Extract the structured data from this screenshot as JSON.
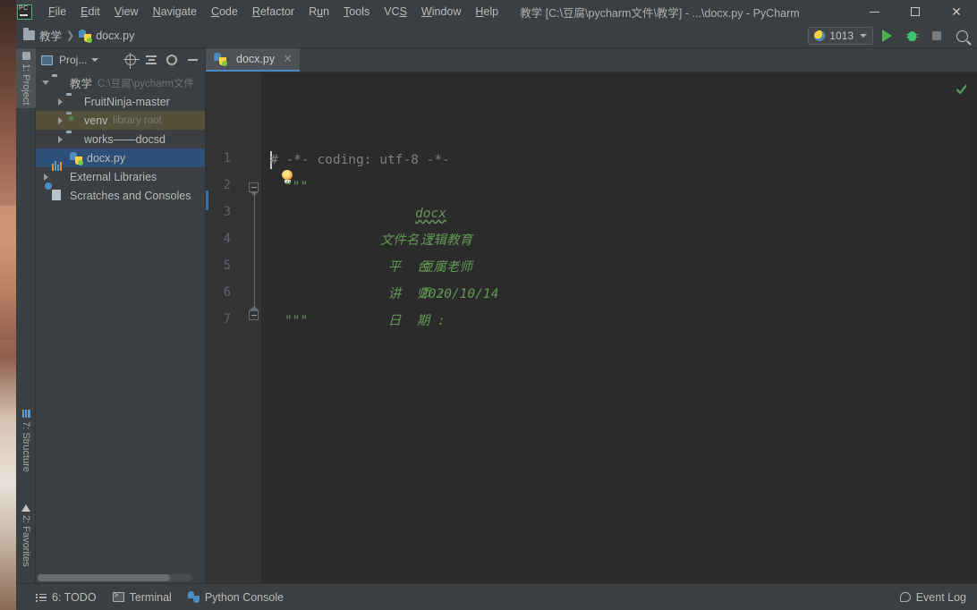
{
  "window": {
    "title": "教学 [C:\\豆腐\\pycharm文件\\教学] - ...\\docx.py - PyCharm",
    "app_logo": "pycharm-logo",
    "minimize": "—",
    "maximize": "□",
    "close": "✕"
  },
  "menu": [
    {
      "label": "File",
      "accel": "F"
    },
    {
      "label": "Edit",
      "accel": "E"
    },
    {
      "label": "View",
      "accel": "V"
    },
    {
      "label": "Navigate",
      "accel": "N"
    },
    {
      "label": "Code",
      "accel": "C"
    },
    {
      "label": "Refactor",
      "accel": "R"
    },
    {
      "label": "Run",
      "accel": "u"
    },
    {
      "label": "Tools",
      "accel": "T"
    },
    {
      "label": "VCS",
      "accel": "S"
    },
    {
      "label": "Window",
      "accel": "W"
    },
    {
      "label": "Help",
      "accel": "H"
    }
  ],
  "breadcrumb": {
    "project": "教学",
    "separator": "❯",
    "file": "docx.py"
  },
  "toolbar": {
    "run_config": "1013",
    "run_icon": "run-triangle-icon",
    "debug_icon": "debug-bug-icon",
    "stop_icon": "stop-square-icon",
    "search_icon": "search-icon"
  },
  "left_tool_tabs": [
    {
      "label": "1: Project",
      "icon": "project-icon",
      "active": true
    },
    {
      "label": "7: Structure",
      "icon": "structure-icon",
      "active": false
    },
    {
      "label": "2: Favorites",
      "icon": "star-icon",
      "active": false
    }
  ],
  "project_panel": {
    "title": "Proj...",
    "buttons": [
      "locate-icon",
      "collapse-all-icon",
      "settings-gear-icon",
      "hide-icon"
    ],
    "tree": [
      {
        "label": "教学",
        "hint": "C:\\豆腐\\pycharm文件",
        "icon": "folder-icon",
        "expanded": true,
        "indent": 0,
        "state": "normal"
      },
      {
        "label": "FruitNinja-master",
        "hint": "",
        "icon": "folder-icon",
        "expanded": false,
        "indent": 1,
        "state": "normal"
      },
      {
        "label": "venv",
        "hint": "library root",
        "icon": "folder-venv-icon",
        "expanded": false,
        "indent": 1,
        "state": "hover"
      },
      {
        "label": "works——docsd",
        "hint": "",
        "icon": "folder-icon",
        "expanded": false,
        "indent": 1,
        "state": "normal"
      },
      {
        "label": "docx.py",
        "hint": "",
        "icon": "python-file-icon",
        "expanded": null,
        "indent": 2,
        "state": "selected"
      },
      {
        "label": "External Libraries",
        "hint": "",
        "icon": "libraries-icon",
        "expanded": false,
        "indent": 0,
        "state": "normal"
      },
      {
        "label": "Scratches and Consoles",
        "hint": "",
        "icon": "scratches-icon",
        "expanded": null,
        "indent": 0,
        "state": "normal"
      }
    ]
  },
  "editor": {
    "tab": {
      "label": "docx.py",
      "icon": "python-file-icon",
      "close": "✕"
    },
    "line_numbers": [
      "1",
      "2",
      "3",
      "4",
      "5",
      "6",
      "7"
    ],
    "lines": [
      {
        "n": 1,
        "text": "# -*- coding: utf-8 -*-",
        "style": "comment"
      },
      {
        "n": 2,
        "text": "\"\"\"",
        "style": "doc-plain"
      },
      {
        "n": 3,
        "text": "    文件名 :        docx",
        "style": "doc"
      },
      {
        "n": 4,
        "text": "     平  台 :         逻辑教育",
        "style": "doc"
      },
      {
        "n": 5,
        "text": "     讲  师 :         豆腐老师",
        "style": "doc"
      },
      {
        "n": 6,
        "text": "     日  期 :        2020/10/14",
        "style": "doc"
      },
      {
        "n": 7,
        "text": "\"\"\"",
        "style": "doc-plain"
      }
    ],
    "docstring_rows": [
      {
        "label": "文件名 :",
        "value": "docx",
        "typo": true
      },
      {
        "label": "平  台 :",
        "value": "逻辑教育",
        "typo": false
      },
      {
        "label": "讲  师 :",
        "value": "豆腐老师",
        "typo": false
      },
      {
        "label": "日  期 :",
        "value": "2020/10/14",
        "typo": false
      }
    ],
    "intention_icon": "lightbulb-icon",
    "inspection_status": "inspection-ok-check-icon",
    "fold_start_icon": "fold-collapse-icon",
    "fold_end_icon": "fold-collapse-end-icon"
  },
  "statusbar": {
    "items": [
      {
        "label": "6: TODO",
        "accel": "6",
        "icon": "todo-icon"
      },
      {
        "label": "Terminal",
        "accel": "",
        "icon": "terminal-icon"
      },
      {
        "label": "Python Console",
        "accel": "",
        "icon": "python-console-icon"
      }
    ],
    "event_log": {
      "label": "Event Log",
      "icon": "event-log-icon"
    }
  },
  "colors": {
    "accent_blue": "#4a88c7",
    "selection_blue": "#2d4f78",
    "hover_olive": "#54503a",
    "docstring_green": "#629755",
    "comment_gray": "#808080",
    "panel_bg": "#3c3f41",
    "editor_bg": "#2b2b2b",
    "gutter_bg": "#313335",
    "run_green": "#4caf50"
  }
}
